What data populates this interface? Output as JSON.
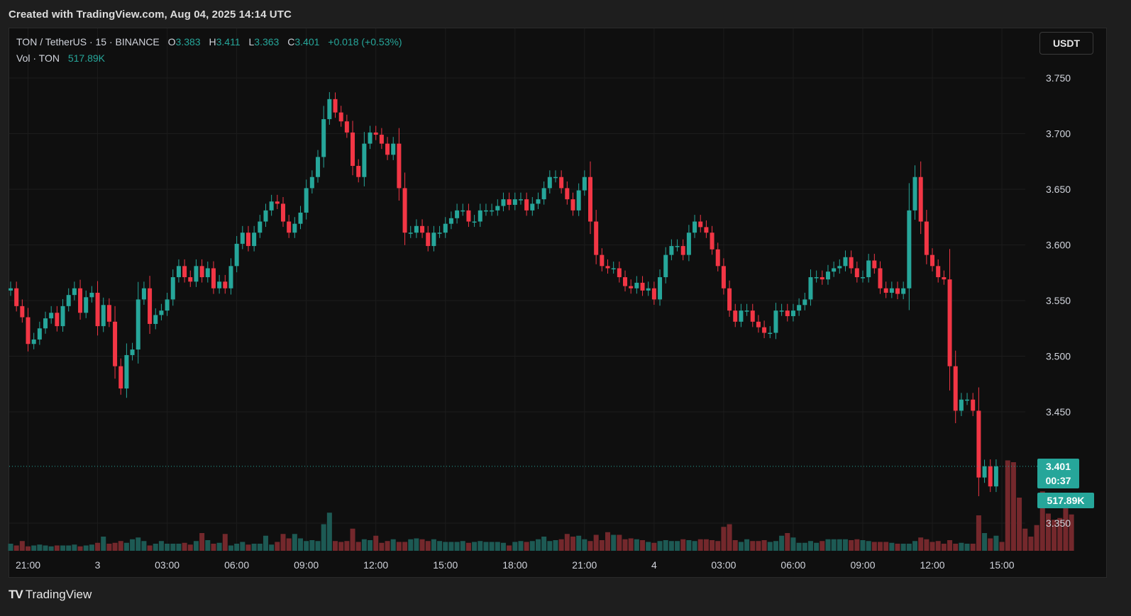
{
  "header": {
    "created_text": "Created with TradingView.com, Aug 04, 2025 14:14 UTC"
  },
  "legend": {
    "symbol": "TON / TetherUS · 15 · BINANCE",
    "open_label": "O",
    "open": "3.383",
    "high_label": "H",
    "high": "3.411",
    "low_label": "L",
    "low": "3.363",
    "close_label": "C",
    "close": "3.401",
    "change": "+0.018 (+0.53%)",
    "vol_label": "Vol · TON",
    "vol_value": "517.89K"
  },
  "currency_button": "USDT",
  "last_price": {
    "price": "3.401",
    "countdown": "00:37",
    "volume": "517.89K"
  },
  "footer": {
    "brand": "TradingView",
    "brand_mark": "TV"
  },
  "colors": {
    "up": "#26a69a",
    "down": "#f23645",
    "background": "#0f0f0f",
    "grid": "#1c1c1c",
    "axis_text": "#d1d4dc"
  },
  "chart_data": {
    "type": "candlestick",
    "symbol": "TON / TetherUS",
    "interval": "15",
    "exchange": "BINANCE",
    "y_ticks": [
      "3.750",
      "3.700",
      "3.650",
      "3.600",
      "3.550",
      "3.500",
      "3.450",
      "3.350"
    ],
    "y_tick_values": [
      3.75,
      3.7,
      3.65,
      3.6,
      3.55,
      3.5,
      3.45,
      3.35
    ],
    "ylim": [
      3.325,
      3.775
    ],
    "x_ticks": [
      "21:00",
      "3",
      "03:00",
      "06:00",
      "09:00",
      "12:00",
      "15:00",
      "18:00",
      "21:00",
      "4",
      "03:00",
      "06:00",
      "09:00",
      "12:00",
      "15:00"
    ],
    "x_tick_slots": [
      3,
      15,
      27,
      39,
      51,
      63,
      75,
      87,
      99,
      111,
      123,
      135,
      147,
      159,
      171
    ],
    "grid": true,
    "volume_max_k": 1000,
    "closes": [
      3.561,
      3.545,
      3.535,
      3.511,
      3.515,
      3.525,
      3.534,
      3.539,
      3.527,
      3.545,
      3.555,
      3.561,
      3.539,
      3.553,
      3.557,
      3.527,
      3.546,
      3.531,
      3.491,
      3.471,
      3.501,
      3.506,
      3.551,
      3.561,
      3.529,
      3.537,
      3.541,
      3.551,
      3.571,
      3.581,
      3.571,
      3.567,
      3.581,
      3.571,
      3.579,
      3.561,
      3.567,
      3.561,
      3.581,
      3.601,
      3.611,
      3.599,
      3.611,
      3.621,
      3.631,
      3.639,
      3.637,
      3.621,
      3.611,
      3.619,
      3.629,
      3.651,
      3.661,
      3.679,
      3.713,
      3.731,
      3.719,
      3.711,
      3.701,
      3.671,
      3.661,
      3.691,
      3.701,
      3.699,
      3.691,
      3.681,
      3.691,
      3.651,
      3.611,
      3.611,
      3.617,
      3.611,
      3.599,
      3.611,
      3.611,
      3.619,
      3.624,
      3.631,
      3.631,
      3.621,
      3.621,
      3.631,
      3.631,
      3.631,
      3.635,
      3.641,
      3.636,
      3.641,
      3.641,
      3.631,
      3.637,
      3.641,
      3.651,
      3.661,
      3.661,
      3.651,
      3.641,
      3.631,
      3.649,
      3.661,
      3.621,
      3.591,
      3.581,
      3.579,
      3.579,
      3.571,
      3.563,
      3.561,
      3.566,
      3.559,
      3.561,
      3.551,
      3.571,
      3.591,
      3.599,
      3.599,
      3.591,
      3.611,
      3.621,
      3.616,
      3.611,
      3.596,
      3.581,
      3.561,
      3.541,
      3.531,
      3.541,
      3.541,
      3.531,
      3.526,
      3.521,
      3.521,
      3.541,
      3.541,
      3.536,
      3.541,
      3.546,
      3.551,
      3.571,
      3.571,
      3.569,
      3.576,
      3.579,
      3.581,
      3.589,
      3.579,
      3.571,
      3.571,
      3.586,
      3.579,
      3.561,
      3.557,
      3.561,
      3.556,
      3.561,
      3.631,
      3.661,
      3.621,
      3.591,
      3.581,
      3.571,
      3.569,
      3.491,
      3.451,
      3.461,
      3.461,
      3.451,
      3.391,
      3.401,
      3.383,
      3.401
    ],
    "volumes_k": [
      80,
      60,
      110,
      50,
      60,
      70,
      60,
      50,
      60,
      60,
      60,
      70,
      50,
      60,
      70,
      90,
      160,
      80,
      90,
      110,
      90,
      130,
      150,
      110,
      60,
      80,
      110,
      80,
      80,
      80,
      90,
      70,
      110,
      200,
      120,
      80,
      90,
      190,
      60,
      80,
      100,
      70,
      80,
      80,
      170,
      70,
      100,
      190,
      140,
      190,
      140,
      110,
      120,
      110,
      300,
      430,
      110,
      100,
      110,
      250,
      100,
      130,
      120,
      170,
      90,
      110,
      130,
      100,
      100,
      130,
      140,
      130,
      110,
      130,
      110,
      100,
      100,
      100,
      110,
      90,
      100,
      110,
      100,
      100,
      100,
      90,
      60,
      100,
      110,
      100,
      110,
      130,
      160,
      110,
      120,
      130,
      190,
      160,
      170,
      130,
      110,
      180,
      120,
      210,
      180,
      180,
      130,
      140,
      130,
      120,
      100,
      90,
      110,
      120,
      110,
      110,
      130,
      120,
      110,
      130,
      130,
      120,
      110,
      270,
      300,
      120,
      100,
      130,
      110,
      110,
      120,
      100,
      110,
      170,
      200,
      150,
      90,
      90,
      110,
      90,
      110,
      130,
      130,
      130,
      130,
      120,
      130,
      120,
      110,
      100,
      100,
      100,
      90,
      80,
      80,
      80,
      110,
      150,
      130,
      100,
      110,
      80,
      120,
      80,
      90,
      80,
      80,
      400,
      200,
      140,
      170,
      100,
      1020,
      1000,
      600,
      250,
      160,
      290,
      670,
      420,
      350,
      370,
      520,
      410
    ]
  }
}
